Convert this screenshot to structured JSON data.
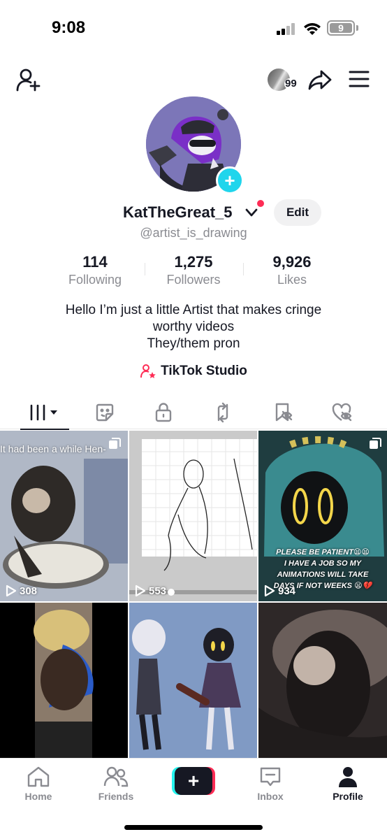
{
  "status_bar": {
    "time": "9:08",
    "battery": "9"
  },
  "top_bar": {
    "profile_views_count": "99"
  },
  "profile": {
    "display_name": "KatTheGreat_5",
    "handle": "@artist_is_drawing",
    "edit_label": "Edit",
    "stats": [
      {
        "value": "114",
        "label": "Following"
      },
      {
        "value": "1,275",
        "label": "Followers"
      },
      {
        "value": "9,926",
        "label": "Likes"
      }
    ],
    "bio_lines": [
      "Hello I’m just a little Artist that makes cringe",
      "worthy videos",
      "They/them pron"
    ],
    "studio_label": "TikTok Studio"
  },
  "tabs": [
    {
      "icon": "videos-grid-icon",
      "active": true
    },
    {
      "icon": "sticker-icon",
      "active": false
    },
    {
      "icon": "lock-icon",
      "active": false
    },
    {
      "icon": "repost-icon",
      "active": false
    },
    {
      "icon": "bookmark-hidden-icon",
      "active": false
    },
    {
      "icon": "liked-hidden-icon",
      "active": false
    }
  ],
  "videos": [
    {
      "overlay_text": "It had been a while Hen-",
      "views": "308"
    },
    {
      "views": "553"
    },
    {
      "caption_lines": [
        "PLEASE BE PATIENT😫😫",
        "I HAVE A JOB SO MY",
        "ANIMATIONS WILL TAKE",
        "DAYS IF NOT WEEKS 😫💔"
      ],
      "views": "934"
    },
    {},
    {},
    {}
  ],
  "bottom_nav": {
    "home": "Home",
    "friends": "Friends",
    "create": "+",
    "inbox": "Inbox",
    "profile": "Profile"
  },
  "colors": {
    "accent_red": "#fe2c55",
    "accent_cyan": "#20d5ec",
    "text": "#161823",
    "muted": "#8a8b91"
  }
}
